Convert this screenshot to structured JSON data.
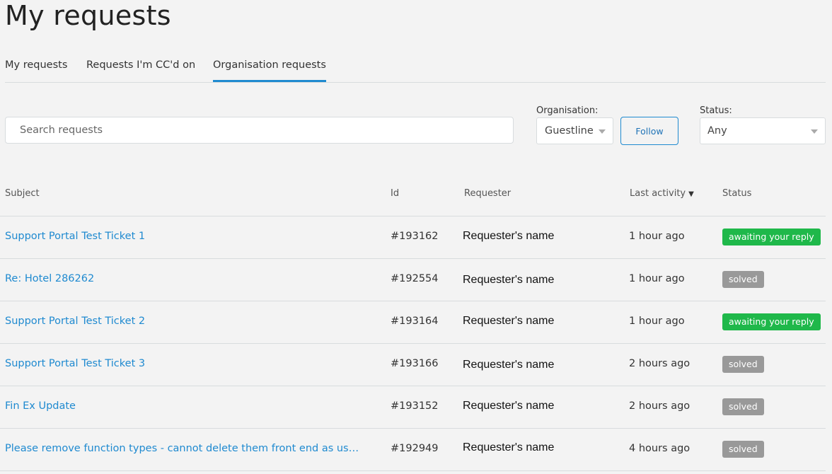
{
  "page": {
    "title": "My requests"
  },
  "tabs": [
    {
      "label": "My requests",
      "active": false
    },
    {
      "label": "Requests I'm CC'd on",
      "active": false
    },
    {
      "label": "Organisation requests",
      "active": true
    }
  ],
  "search": {
    "placeholder": "Search requests",
    "value": ""
  },
  "filters": {
    "organisation": {
      "label": "Organisation:",
      "value": "Guestline"
    },
    "follow_label": "Follow",
    "status": {
      "label": "Status:",
      "value": "Any"
    }
  },
  "table": {
    "headers": {
      "subject": "Subject",
      "id": "Id",
      "requester": "Requester",
      "last_activity": "Last activity",
      "status": "Status"
    },
    "sort_indicator": "▼",
    "rows": [
      {
        "subject": "Support Portal Test Ticket 1",
        "id": "#193162",
        "requester": "Requester's name",
        "last_activity": "1 hour ago",
        "status": "awaiting your reply",
        "status_color": "#1fb84a"
      },
      {
        "subject": "Re: Hotel 286262",
        "id": "#192554",
        "requester": "Requester's name",
        "last_activity": "1 hour ago",
        "status": "solved",
        "status_color": "#999999"
      },
      {
        "subject": "Support Portal Test Ticket 2",
        "id": "#193164",
        "requester": "Requester's name",
        "last_activity": "1 hour ago",
        "status": "awaiting your reply",
        "status_color": "#1fb84a"
      },
      {
        "subject": "Support Portal Test Ticket 3",
        "id": "#193166",
        "requester": "Requester's name",
        "last_activity": "2 hours ago",
        "status": "solved",
        "status_color": "#999999"
      },
      {
        "subject": "Fin Ex Update",
        "id": "#193152",
        "requester": "Requester's name",
        "last_activity": "2 hours ago",
        "status": "solved",
        "status_color": "#999999"
      },
      {
        "subject": "Please remove function types - cannot delete them front end as used ...",
        "id": "#192949",
        "requester": "Requester's name",
        "last_activity": "4 hours ago",
        "status": "solved",
        "status_color": "#999999"
      }
    ]
  },
  "colors": {
    "accent": "#1f8ad0",
    "awaiting": "#1fb84a",
    "solved": "#999999"
  }
}
